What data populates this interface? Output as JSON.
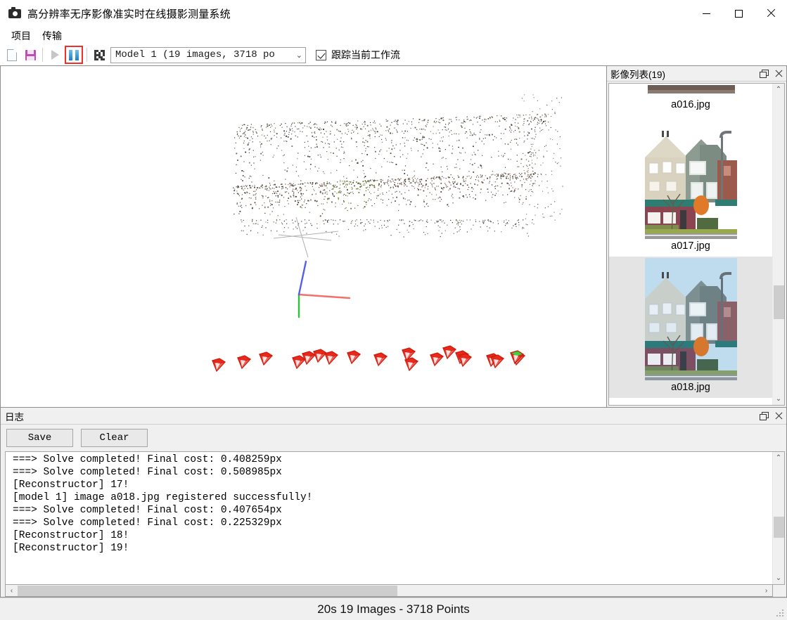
{
  "window": {
    "title": "高分辨率无序影像准实时在线摄影测量系统",
    "icon": "camera-icon",
    "minimize_label": "—",
    "maximize_label": "□",
    "close_label": "✕"
  },
  "menubar": {
    "items": [
      {
        "label": "项目"
      },
      {
        "label": "传输"
      }
    ]
  },
  "toolbar": {
    "new_icon": "new-document-icon",
    "save_icon": "save-floppy-icon",
    "play_icon": "play-icon",
    "pause_icon": "pause-icon",
    "pause_highlighted": true,
    "highlight_color": "#f03029",
    "feature_icon": "qr-code-icon",
    "model_combo": {
      "value": "Model 1 (19 images, 3718 po",
      "arrow": "⌄"
    },
    "track_checkbox": {
      "label": "跟踪当前工作流",
      "checked": true
    }
  },
  "viewport": {
    "name": "3d-point-cloud-viewport",
    "background": "#ffffff",
    "axes": {
      "x_color": "#e8463c",
      "y_color": "#2fc236",
      "z_color": "#5560e6"
    },
    "camera_color": "#e8291c",
    "camera_highlight_color": "#3fd13f",
    "camera_count": 19
  },
  "image_list": {
    "title": "影像列表(19)",
    "restore_icon": "restore-icon",
    "close_icon": "close-icon",
    "items": [
      {
        "name": "a016.jpg",
        "selected": false,
        "cut_off": true
      },
      {
        "name": "a017.jpg",
        "selected": false,
        "cut_off": false
      },
      {
        "name": "a018.jpg",
        "selected": true,
        "cut_off": false
      }
    ],
    "scrollbar": {
      "up": "⌃",
      "down": "⌄"
    }
  },
  "log_panel": {
    "title": "日志",
    "restore_icon": "restore-icon",
    "close_icon": "close-icon",
    "save_button": "Save",
    "clear_button": "Clear",
    "lines": [
      "===> Solve completed! Final cost: 0.408259px",
      "===> Solve completed! Final cost: 0.508985px",
      "[Reconstructor] 17!",
      "[model 1] image a018.jpg registered successfully!",
      "===> Solve completed! Final cost: 0.407654px",
      "===> Solve completed! Final cost: 0.225329px",
      "[Reconstructor] 18!",
      "[Reconstructor] 19!"
    ],
    "scroll_left": "‹",
    "scroll_right": "›",
    "scroll_up": "⌃",
    "scroll_down": "⌄"
  },
  "statusbar": {
    "text": "20s  19 Images - 3718 Points"
  }
}
